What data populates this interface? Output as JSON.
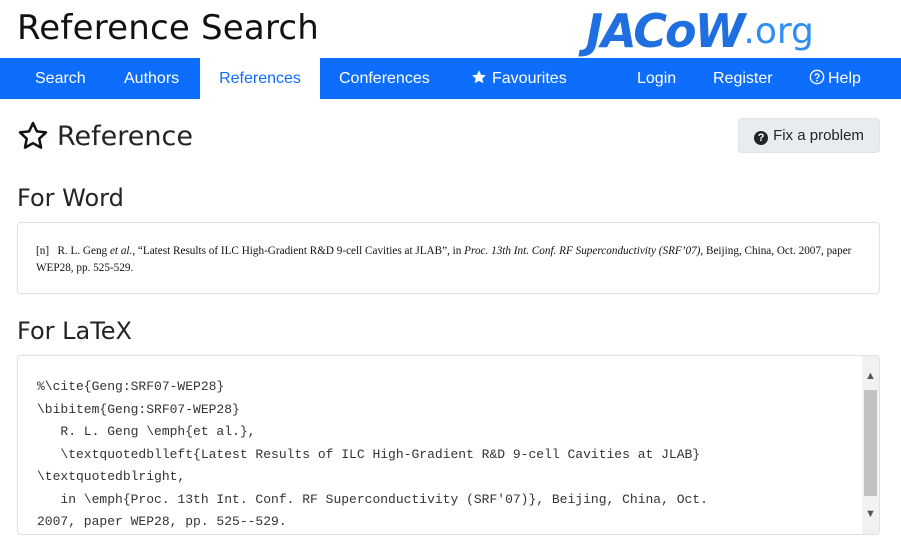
{
  "header": {
    "title": "Reference Search",
    "logo_main": "JACoW",
    "logo_tld": ".org"
  },
  "nav": {
    "items": [
      {
        "label": "Search",
        "active": false
      },
      {
        "label": "Authors",
        "active": false
      },
      {
        "label": "References",
        "active": true
      },
      {
        "label": "Conferences",
        "active": false
      },
      {
        "label": "Favourites",
        "icon": "star-icon",
        "active": false
      },
      {
        "label": "Login",
        "active": false
      },
      {
        "label": "Register",
        "active": false
      },
      {
        "label": "Help",
        "icon": "question-circle-icon",
        "active": false
      }
    ]
  },
  "page": {
    "title": "Reference",
    "fix_button": "Fix a problem"
  },
  "word": {
    "heading": "For Word",
    "num": "[n]",
    "authors": "R. L. Geng",
    "etal": "et al.",
    "title_part": ", “Latest Results of ILC High-Gradient R&D 9-cell Cavities at JLAB”, in ",
    "proc": "Proc. 13th Int. Conf. RF Superconductivity (SRF’07)",
    "rest": ", Beijing, China, Oct. 2007, paper WEP28, pp. 525-529."
  },
  "latex": {
    "heading": "For LaTeX",
    "lines": [
      "%\\cite{Geng:SRF07-WEP28}",
      "\\bibitem{Geng:SRF07-WEP28}",
      "   R. L. Geng \\emph{et al.},",
      "   \\textquotedblleft{Latest Results of ILC High-Gradient R&D 9-cell Cavities at JLAB}",
      "\\textquotedblright,",
      "   in \\emph{Proc. 13th Int. Conf. RF Superconductivity (SRF'07)}, Beijing, China, Oct.",
      "2007, paper WEP28, pp. 525--529."
    ]
  },
  "colors": {
    "nav_bg": "#0d6efd",
    "logo": "#1f6fe0"
  }
}
